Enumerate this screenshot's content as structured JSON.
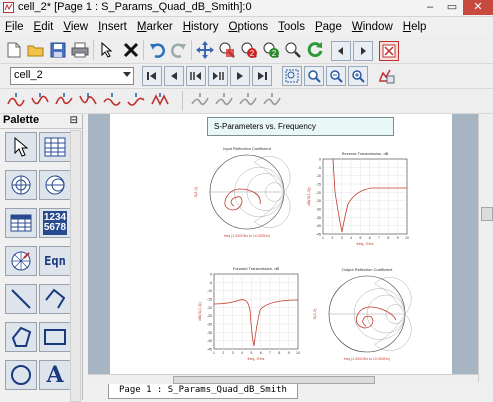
{
  "window": {
    "title": "cell_2* [Page 1 : S_Params_Quad_dB_Smith]:0"
  },
  "menu": [
    {
      "label": "File",
      "u": "F",
      "rest": "ile"
    },
    {
      "label": "Edit",
      "u": "E",
      "rest": "dit"
    },
    {
      "label": "View",
      "u": "V",
      "rest": "iew"
    },
    {
      "label": "Insert",
      "u": "I",
      "rest": "nsert"
    },
    {
      "label": "Marker",
      "u": "M",
      "rest": "arker"
    },
    {
      "label": "History",
      "u": "H",
      "rest": "istory"
    },
    {
      "label": "Options",
      "u": "O",
      "rest": "ptions"
    },
    {
      "label": "Tools",
      "u": "T",
      "rest": "ools"
    },
    {
      "label": "Page",
      "u": "P",
      "rest": "age"
    },
    {
      "label": "Window",
      "u": "W",
      "rest": "indow"
    },
    {
      "label": "Help",
      "u": "H",
      "rest": "elp"
    }
  ],
  "cell_selector": {
    "value": "cell_2"
  },
  "palette": {
    "title": "Palette",
    "items": [
      {
        "name": "select-arrow-icon"
      },
      {
        "name": "table-grid-icon"
      },
      {
        "name": "polar-plot-icon"
      },
      {
        "name": "smith-chart-icon"
      },
      {
        "name": "stacked-table-icon"
      },
      {
        "name": "numeric-display-icon",
        "text1": "1234",
        "text2": "5678"
      },
      {
        "name": "antenna-plot-icon"
      },
      {
        "name": "equation-icon",
        "text": "Eqn"
      },
      {
        "name": "line-icon"
      },
      {
        "name": "polyline-icon"
      },
      {
        "name": "polygon-icon"
      },
      {
        "name": "rectangle-icon"
      },
      {
        "name": "circle-icon"
      },
      {
        "name": "text-icon",
        "text": "A"
      }
    ]
  },
  "page": {
    "heading": "S-Parameters vs. Frequency",
    "tab_label": "Page 1 : S_Params_Quad_dB_Smith"
  },
  "plots": {
    "s11_title": "Input Reflection Coefficient",
    "s22_title": "Output Reflection Coefficient",
    "s21_title": "Forward Transmission, dB",
    "s12_title": "Reverse Transmission, dB",
    "smith_freq_label": "freq (1.000GHz to 10.00GHz)",
    "s11_axis": "S(1,1)",
    "s22_axis": "S(2,2)",
    "s21_axis": "dB(S(2,1))",
    "s12_axis": "dB(S(1,2))",
    "freq_xlabel": "freq, GHz",
    "freq_xticks": [
      "1",
      "2",
      "3",
      "4",
      "5",
      "6",
      "7",
      "8",
      "9",
      "10"
    ],
    "yticks": [
      "0",
      "-5",
      "-10",
      "-15",
      "-20",
      "-25",
      "-30",
      "-35",
      "-40",
      "-45"
    ]
  },
  "colors": {
    "trace": "#c0392b",
    "page_bg": "#a7b4c1",
    "title_box": "#eaf7f7"
  }
}
